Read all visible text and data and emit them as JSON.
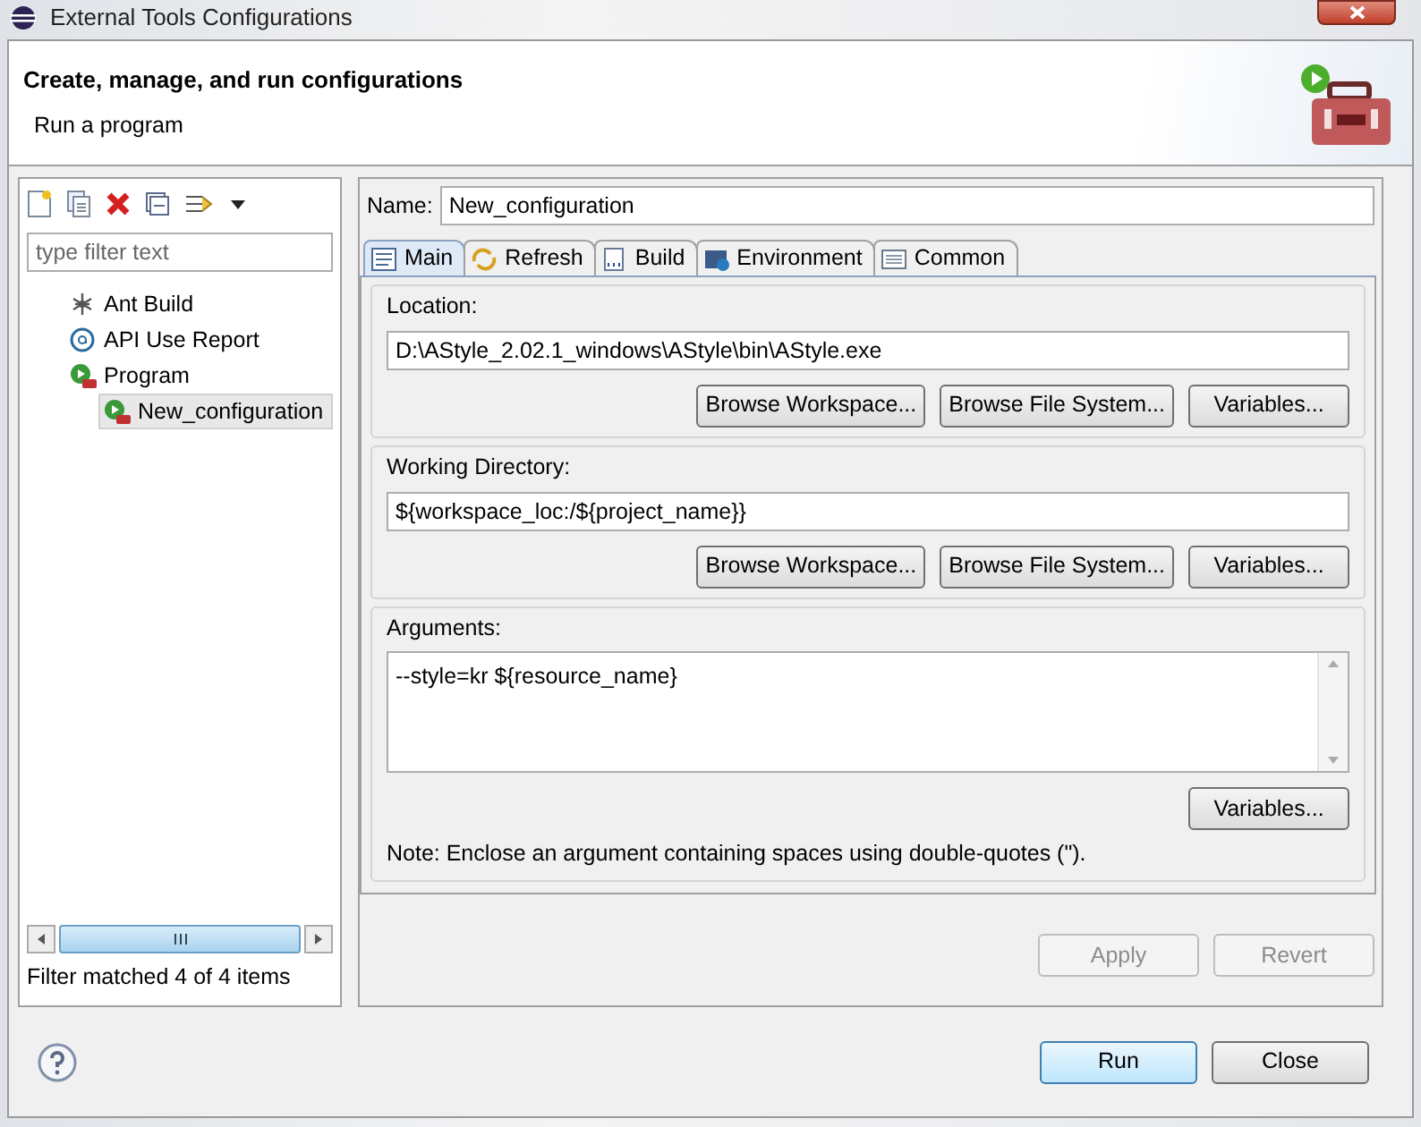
{
  "window": {
    "title": "External Tools Configurations"
  },
  "header": {
    "title": "Create, manage, and run configurations",
    "subtitle": "Run a program"
  },
  "filter": {
    "placeholder": "type filter text"
  },
  "tree": [
    {
      "label": "Ant Build",
      "kind": "ant",
      "selected": false
    },
    {
      "label": "API Use Report",
      "kind": "api",
      "selected": false
    },
    {
      "label": "Program",
      "kind": "program",
      "selected": false,
      "children": [
        {
          "label": "New_configuration",
          "kind": "program",
          "selected": true
        }
      ]
    }
  ],
  "filter_status": "Filter matched 4 of 4 items",
  "name": {
    "label": "Name:",
    "value": "New_configuration"
  },
  "tabs": [
    {
      "label": "Main",
      "kind": "main",
      "selected": true
    },
    {
      "label": "Refresh",
      "kind": "refresh",
      "selected": false
    },
    {
      "label": "Build",
      "kind": "build",
      "selected": false
    },
    {
      "label": "Environment",
      "kind": "environment",
      "selected": false
    },
    {
      "label": "Common",
      "kind": "common",
      "selected": false
    }
  ],
  "groups": [
    {
      "label": "Location:",
      "kind": "line",
      "value": "D:\\AStyle_2.02.1_windows\\AStyle\\bin\\AStyle.exe",
      "buttons": [
        "Browse Workspace...",
        "Browse File System...",
        "Variables..."
      ]
    },
    {
      "label": "Working Directory:",
      "kind": "line",
      "value": "${workspace_loc:/${project_name}}",
      "buttons": [
        "Browse Workspace...",
        "Browse File System...",
        "Variables..."
      ]
    },
    {
      "label": "Arguments:",
      "kind": "area",
      "value": "--style=kr ${resource_name}",
      "buttons": [
        "Variables..."
      ],
      "note": "Note: Enclose an argument containing spaces using double-quotes (\")."
    }
  ],
  "config_buttons": [
    {
      "label": "Apply",
      "disabled": true
    },
    {
      "label": "Revert",
      "disabled": true
    }
  ],
  "dialog_buttons": [
    {
      "label": "Run",
      "default": true
    },
    {
      "label": "Close",
      "default": false
    }
  ]
}
